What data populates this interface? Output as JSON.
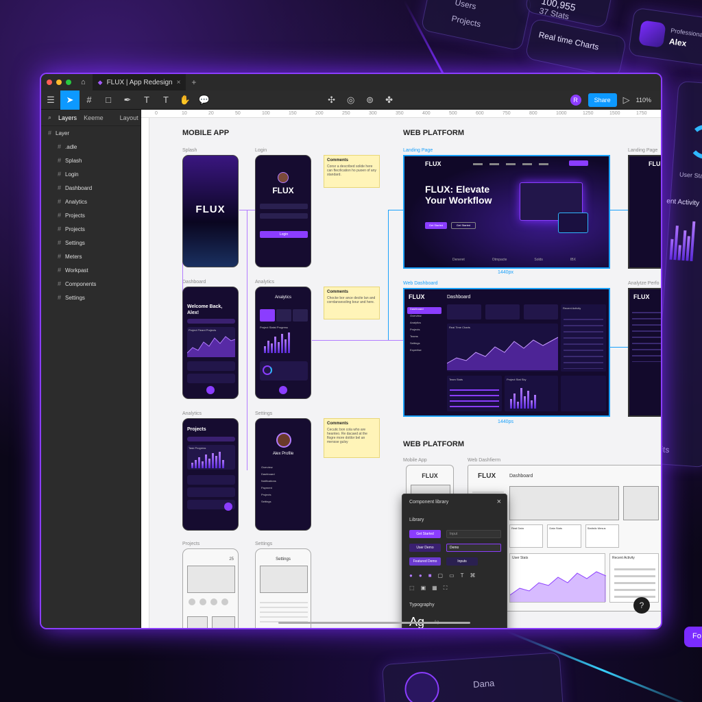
{
  "window": {
    "tab_title": "FLUX | App Redesign"
  },
  "toolbar": {
    "share_label": "Share",
    "zoom": "110%",
    "avatar_initial": "R"
  },
  "sidebar": {
    "tab_layers": "Layers",
    "tab_assets": "Keeme",
    "tab_layout": "Layout",
    "root": "Layer",
    "items": [
      ".adle",
      "Splash",
      "Login",
      "Dashboard",
      "Analytics",
      "Projects",
      "Projects",
      "Settings",
      "Meters",
      "Workpast",
      "Components",
      "Settings"
    ]
  },
  "ruler": {
    "ticks": [
      "0",
      "10",
      "20",
      "50",
      "100",
      "150",
      "200",
      "250",
      "300",
      "350",
      "400",
      "500",
      "600",
      "750",
      "800",
      "1000",
      "1250",
      "1500",
      "1750"
    ]
  },
  "canvas": {
    "mobile_title": "MOBILE APP",
    "web_title": "WEB PLATFORM",
    "web_title2": "WEB PLATFORM",
    "labels": {
      "splash": "Splash",
      "login": "Login",
      "dashboard": "Dashboard",
      "analytics": "Analytics",
      "analytics2": "Analytics",
      "settings": "Settings",
      "projects_w": "Projects",
      "settings_w": "Settings",
      "landing": "Landing Page",
      "landing2": "Landing Page",
      "webdash": "Web Dashboard",
      "analyze": "Analytze Perfo",
      "mobile_app_w": "Mobile App",
      "webdash_w": "Web Dashfierm"
    },
    "sizes": [
      "1440px",
      "1440ps"
    ]
  },
  "phones": {
    "splash_brand": "FLUX",
    "login_brand": "FLUX",
    "login_button": "Login",
    "dash_greeting": "Welcome Back, Alex!",
    "dash_chart": "Project Fleant Projects",
    "analytics_title": "Analytics",
    "analytics_sub": "Project Statst Progress",
    "projects_title": "Projects",
    "projects_sub": "Task Progress",
    "settings_name": "Alex Profile",
    "settings_items": [
      "Overview",
      "Dashboard",
      "Notifications",
      "Payment",
      "Projects",
      "Settings"
    ],
    "wire_proj_title": "Projects",
    "wire_proj_num": "25",
    "wire_set_title": "Settings"
  },
  "notes": [
    {
      "title": "Comments",
      "body": "Consr a described solide here can ftecrlication ho puoen of any standard."
    },
    {
      "title": "Comments",
      "body": "Chocke bor ance decite lan and corrdansesoling bour and here."
    },
    {
      "title": "Comments",
      "body": "Cecutic bon cola who are heanteo. Re dacaed at the flogre more dotilor bel an mensse gulsy"
    }
  ],
  "web": {
    "brand": "FLUX",
    "hero": "FLUX: Elevate Your Workflow",
    "cta1": "Get Started",
    "cta2": "Get Started",
    "logos": [
      "Deneret",
      "Otmpacte",
      "Solds",
      "IBX"
    ],
    "dash_title": "Dashboard",
    "realtime": "Real Time Charts",
    "recent": "Recent Activity",
    "team": "Team Stats",
    "project_stat": "Project Stat Sky",
    "nav": [
      "Dashboard",
      "Overview",
      "Analytics",
      "Projects",
      "Teams",
      "Settings",
      "Expertise"
    ]
  },
  "wire": {
    "brand": "FLUX",
    "dash": "Dashboard",
    "user_stats": "User Stats",
    "recent": "Recent Activity",
    "cards": [
      "Real Data",
      "Data Stats",
      "Statistic Mesus"
    ]
  },
  "library": {
    "title": "Component library",
    "section": "Library",
    "section2": "Typography",
    "sample": "Ag",
    "sample_small": "Ag",
    "buttons": [
      "Get Started",
      "Input",
      "User Demo",
      "Demo",
      "Featured Demo",
      "Inputs"
    ]
  },
  "backdrop": {
    "users": "Users",
    "projects": "Projects",
    "big_number": "100,955",
    "stats": "37 Stats",
    "realtime": "Real time Charts",
    "user": "Alex",
    "prof": "Professional",
    "user_stats": "User Stats",
    "activity": "ent Activity",
    "units": "Units",
    "dana": "Dana",
    "fo": "Fo"
  }
}
